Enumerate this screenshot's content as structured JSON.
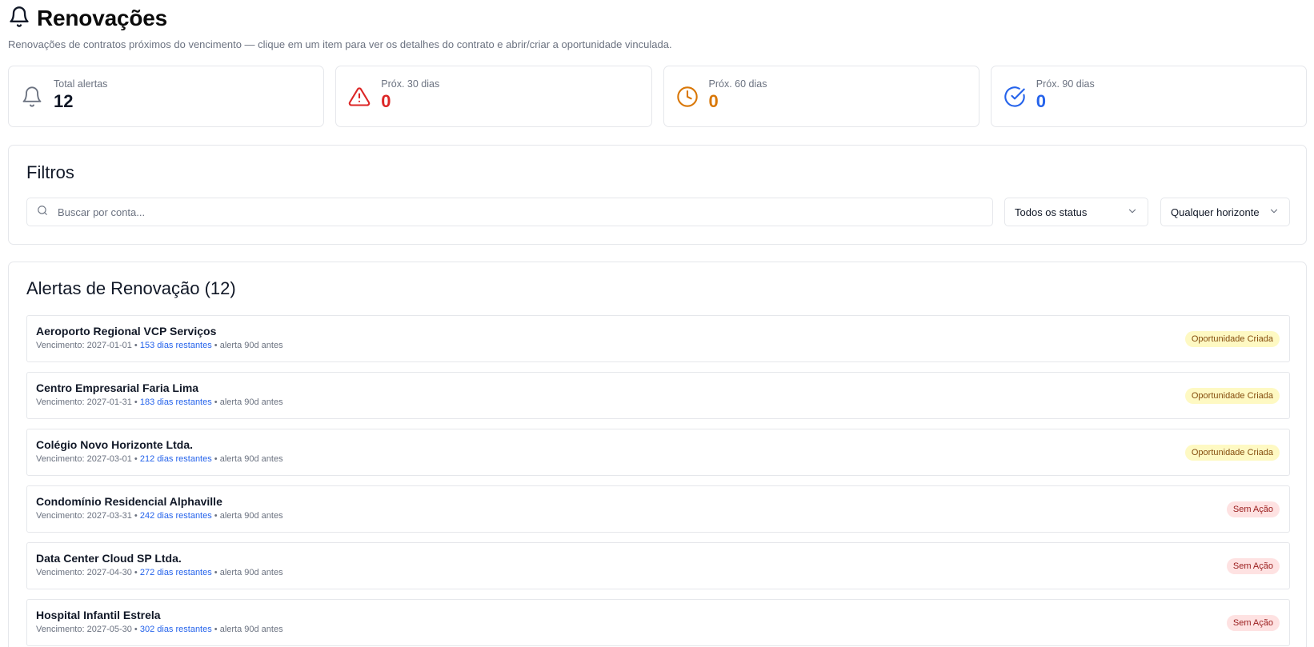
{
  "header": {
    "title": "Renovações",
    "subtitle": "Renovações de contratos próximos do vencimento — clique em um item para ver os detalhes do contrato e abrir/criar a oportunidade vinculada."
  },
  "stats": [
    {
      "label": "Total alertas",
      "value": "12",
      "icon": "bell-icon",
      "color": "#111827",
      "icon_color": "#6b7280"
    },
    {
      "label": "Próx. 30 dias",
      "value": "0",
      "icon": "alert-triangle-icon",
      "color": "#dc2626",
      "icon_color": "#dc2626"
    },
    {
      "label": "Próx. 60 dias",
      "value": "0",
      "icon": "clock-icon",
      "color": "#d97706",
      "icon_color": "#d97706"
    },
    {
      "label": "Próx. 90 dias",
      "value": "0",
      "icon": "check-circle-icon",
      "color": "#2563eb",
      "icon_color": "#2563eb"
    }
  ],
  "filters": {
    "title": "Filtros",
    "search_placeholder": "Buscar por conta...",
    "status_value": "Todos os status",
    "horizon_value": "Qualquer horizonte"
  },
  "alerts": {
    "title": "Alertas de Renovação (12)",
    "items": [
      {
        "name": "Aeroporto Regional VCP Serviços",
        "due": "Vencimento: 2027-01-01",
        "days": "153 dias restantes",
        "alert": "alerta 90d antes",
        "badge": "Oportunidade Criada",
        "badge_type": "created"
      },
      {
        "name": "Centro Empresarial Faria Lima",
        "due": "Vencimento: 2027-01-31",
        "days": "183 dias restantes",
        "alert": "alerta 90d antes",
        "badge": "Oportunidade Criada",
        "badge_type": "created"
      },
      {
        "name": "Colégio Novo Horizonte Ltda.",
        "due": "Vencimento: 2027-03-01",
        "days": "212 dias restantes",
        "alert": "alerta 90d antes",
        "badge": "Oportunidade Criada",
        "badge_type": "created"
      },
      {
        "name": "Condomínio Residencial Alphaville",
        "due": "Vencimento: 2027-03-31",
        "days": "242 dias restantes",
        "alert": "alerta 90d antes",
        "badge": "Sem Ação",
        "badge_type": "none"
      },
      {
        "name": "Data Center Cloud SP Ltda.",
        "due": "Vencimento: 2027-04-30",
        "days": "272 dias restantes",
        "alert": "alerta 90d antes",
        "badge": "Sem Ação",
        "badge_type": "none"
      },
      {
        "name": "Hospital Infantil Estrela",
        "due": "Vencimento: 2027-05-30",
        "days": "302 dias restantes",
        "alert": "alerta 90d antes",
        "badge": "Sem Ação",
        "badge_type": "none"
      }
    ]
  },
  "colors": {
    "badge_created_bg": "#fef9c3",
    "badge_created_text": "#854d0e",
    "badge_none_bg": "#fee2e2",
    "badge_none_text": "#991b1b",
    "days_text": "#2563eb"
  }
}
